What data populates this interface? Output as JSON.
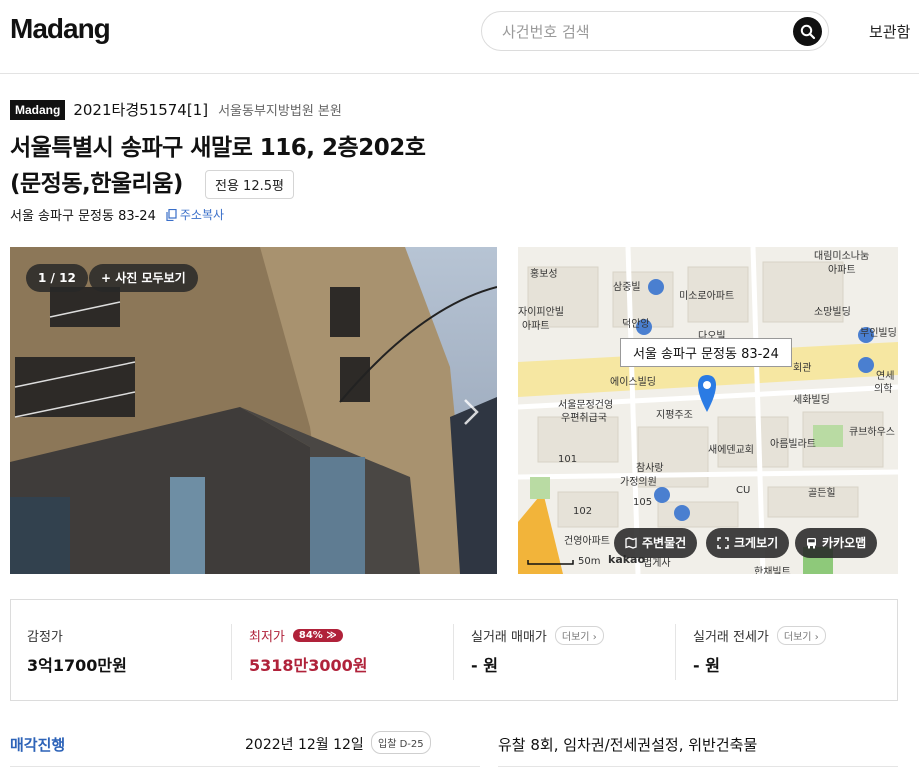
{
  "header": {
    "logo": "Madang",
    "search_placeholder": "사건번호 검색",
    "archive_link": "보관함"
  },
  "case": {
    "badge": "Madang",
    "case_number": "2021타경51574[1]",
    "court": "서울동부지방법원 본원",
    "title_line1": "서울특별시 송파구 새말로 116, 2층202호",
    "title_line2": "(문정동,한울리움)",
    "area_chip": "전용 12.5평",
    "lot_address": "서울 송파구 문정동 83-24",
    "copy_address": "주소복사"
  },
  "photo": {
    "counter": "1 / 12",
    "view_all": "+ 사진 모두보기"
  },
  "map": {
    "address_label": "서울 송파구 문정동 83-24",
    "buttons": {
      "nearby": "주변물건",
      "enlarge": "크게보기",
      "kakao": "카카오맵"
    },
    "labels": [
      "대림미소나눔",
      "아파트",
      "홍보성",
      "삼중빌",
      "미소로아파트",
      "소망빌딩",
      "자이피안빌",
      "아파트",
      "덕안앙",
      "다오빌",
      "부인빌딩",
      "에이스빌딩",
      "회관",
      "연세",
      "의학",
      "서울문정건영",
      "우편취급국",
      "지평주조",
      "세화빌딩",
      "새에덴교회",
      "아름빌라트",
      "큐브하우스",
      "101",
      "참사랑",
      "가정의원",
      "CU",
      "골든힐",
      "102",
      "105",
      "건영아파트",
      "50m",
      "kakao",
      "법게사",
      "한채빌트"
    ],
    "colors": {
      "road": "#f6e7a2",
      "park": "#b9dba3",
      "pin": "#2a7be4"
    }
  },
  "prices": {
    "appraisal": {
      "label": "감정가",
      "value": "3억1700만원"
    },
    "minimum": {
      "label": "최저가",
      "badge": "84%",
      "value": "5318만3000원"
    },
    "sale_trade": {
      "label": "실거래 매매가",
      "more": "더보기",
      "value": "- 원"
    },
    "sale_jeonse": {
      "label": "실거래 전세가",
      "more": "더보기",
      "value": "- 원"
    }
  },
  "schedule": {
    "status": "매각진행",
    "date": "2022년 12월 12일",
    "dday": "입찰 D-25",
    "description": "유찰 8회, 임차권/전세권설정, 위반건축물"
  },
  "colors": {
    "accent_red": "#b0223a",
    "accent_blue": "#2d63b8"
  }
}
